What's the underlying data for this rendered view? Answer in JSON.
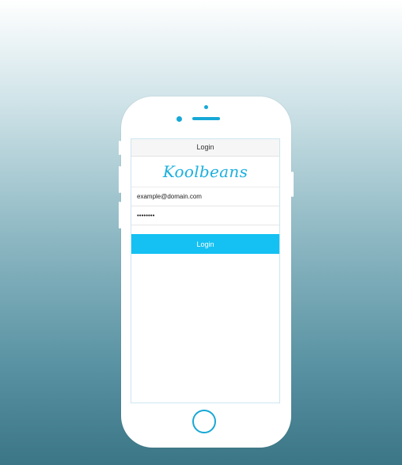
{
  "app": {
    "nav_title": "Login",
    "logo_text": "Koolbeans"
  },
  "form": {
    "email_value": "example@domain.com",
    "password_value": "password",
    "login_label": "Login"
  },
  "colors": {
    "accent": "#14c1f2",
    "brand": "#1cb0df"
  },
  "icons": {
    "camera": "camera-icon",
    "home": "home-button-icon"
  }
}
